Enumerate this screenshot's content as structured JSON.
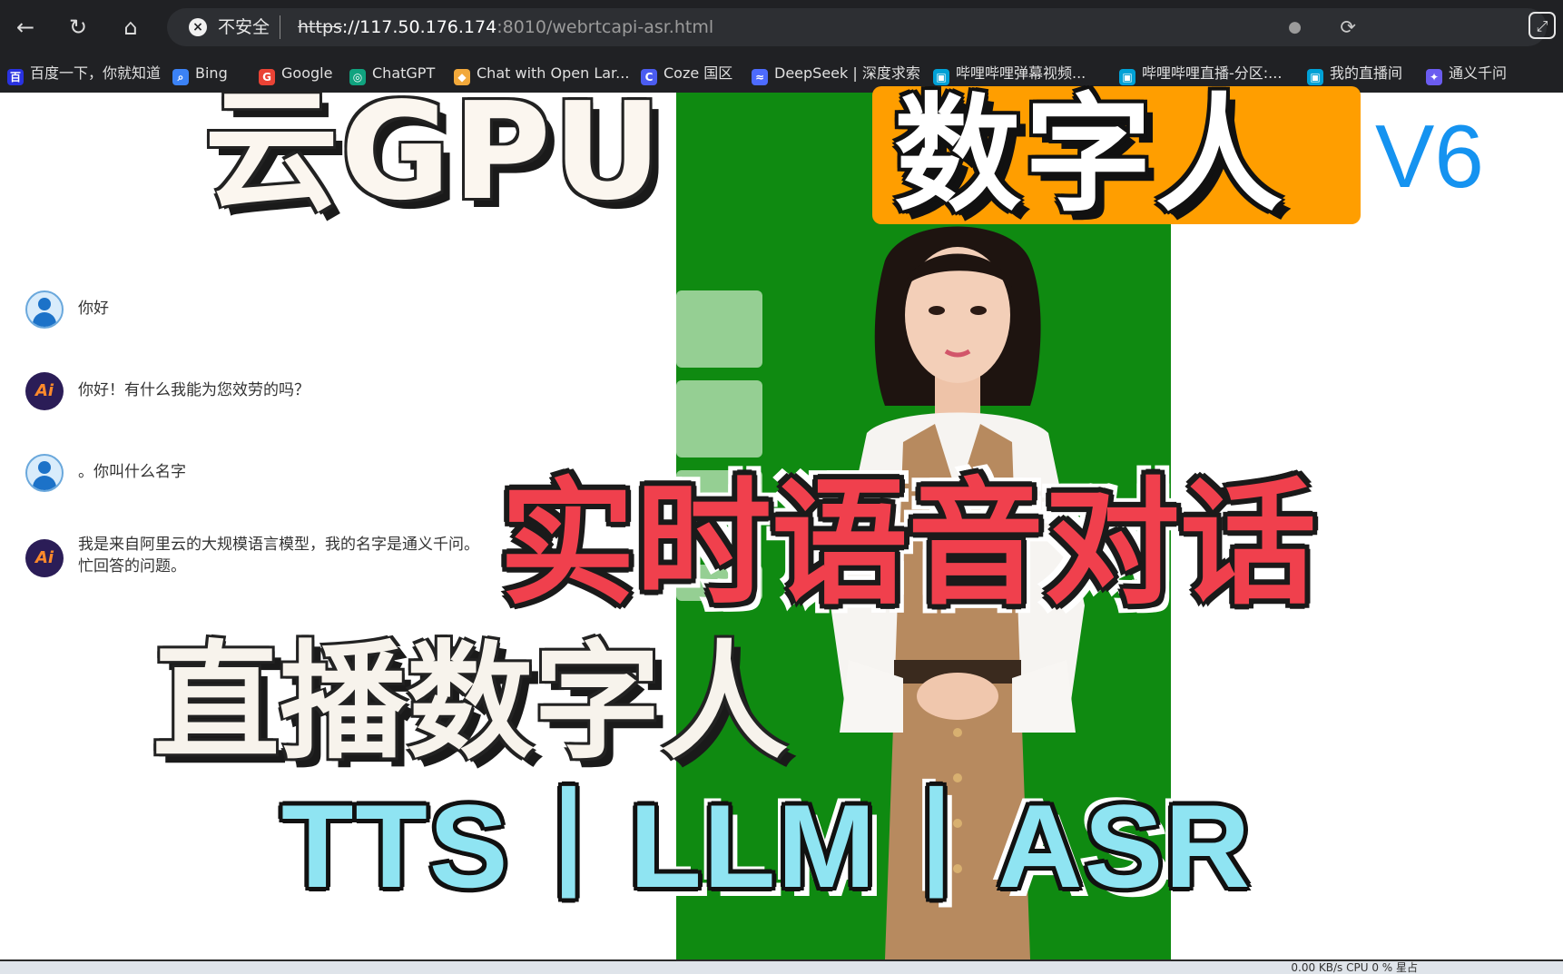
{
  "browser": {
    "address_warning": "不安全",
    "url_scheme": "https",
    "url_host": "://117.50.176.174",
    "url_rest": ":8010/webrtcapi-asr.html",
    "bookmarks": [
      {
        "label": "百度一下，你就知道",
        "icon": "baidu-icon",
        "color": "#2932e1"
      },
      {
        "label": "Bing",
        "icon": "search-icon",
        "color": "#3b82f6"
      },
      {
        "label": "Google",
        "icon": "google-icon",
        "color": "#ea4335"
      },
      {
        "label": "ChatGPT",
        "icon": "chatgpt-icon",
        "color": "#10a37f"
      },
      {
        "label": "Chat with Open Lar...",
        "icon": "chat-icon",
        "color": "#f2a93b"
      },
      {
        "label": "Coze 国区",
        "icon": "coze-icon",
        "color": "#4b5cf0"
      },
      {
        "label": "DeepSeek | 深度求索",
        "icon": "deepseek-icon",
        "color": "#4d6bfe"
      },
      {
        "label": "哔哩哔哩弹幕视频...",
        "icon": "bilibili-icon",
        "color": "#00a1d6"
      },
      {
        "label": "哔哩哔哩直播-分区:...",
        "icon": "bilibili-icon",
        "color": "#00a1d6"
      },
      {
        "label": "我的直播间",
        "icon": "bilibili-icon",
        "color": "#00a1d6"
      },
      {
        "label": "通义千问",
        "icon": "tongyi-icon",
        "color": "#6b5cf0"
      }
    ]
  },
  "chat": {
    "messages": [
      {
        "role": "user",
        "text": "你好"
      },
      {
        "role": "ai",
        "avatar_label": "Ai",
        "text": "你好！有什么我能为您效劳的吗？"
      },
      {
        "role": "user",
        "text": "。你叫什么名字"
      },
      {
        "role": "ai",
        "avatar_label": "Ai",
        "text_line1": "我是来自阿里云的大规模语言模型，我的名字是通义千问。",
        "text_line2": "忙回答的问题。"
      }
    ]
  },
  "overlay": {
    "title_cloud": "云GPU",
    "title_digital": "数字人",
    "version": "V6",
    "title_realtime": "实时语音对话",
    "title_live": "直播数字人",
    "tech": "TTS丨LLM丨ASR",
    "colors": {
      "orange": "#ff9e00",
      "version_blue": "#1593f0",
      "red": "#f0404d",
      "cyan": "#8fe4f2",
      "green_screen": "#0f8a11"
    }
  },
  "taskbar": {
    "tray_text": "0.00 KB/s   CPU 0 %   星占"
  }
}
